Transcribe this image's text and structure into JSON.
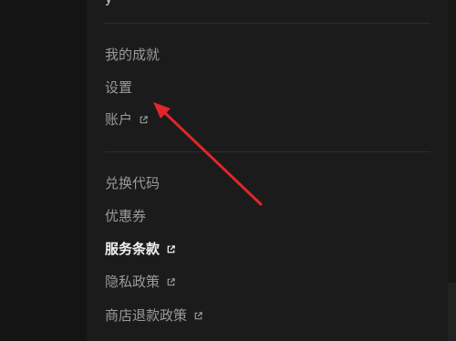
{
  "menu": {
    "top_fragment": "y",
    "items": [
      {
        "label": "我的成就",
        "external": false,
        "active": false
      },
      {
        "label": "设置",
        "external": false,
        "active": false
      },
      {
        "label": "账户",
        "external": true,
        "active": false
      },
      {
        "label": "兑换代码",
        "external": false,
        "active": false
      },
      {
        "label": "优惠券",
        "external": false,
        "active": false
      },
      {
        "label": "服务条款",
        "external": true,
        "active": true
      },
      {
        "label": "隐私政策",
        "external": true,
        "active": false
      },
      {
        "label": "商店退款政策",
        "external": true,
        "active": false
      }
    ]
  },
  "icons": {
    "external": "external-link-icon"
  },
  "annotation": {
    "color": "#e0262b",
    "points_to": "设置"
  }
}
